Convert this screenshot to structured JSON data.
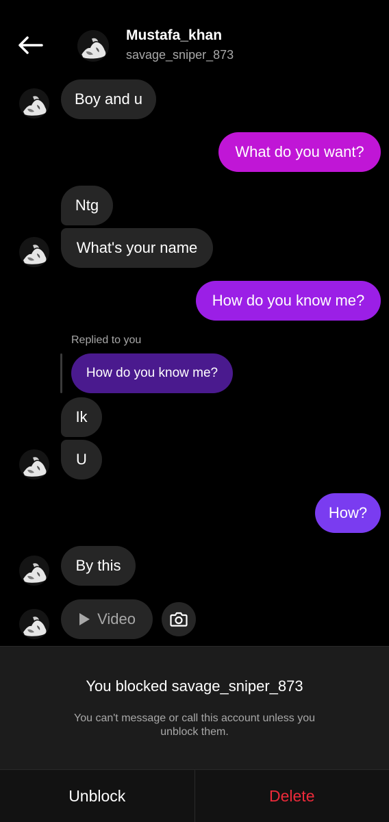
{
  "header": {
    "name": "Mustafa_khan",
    "username": "savage_sniper_873"
  },
  "messages": {
    "m1": "Boy and u",
    "m2": "What do you want?",
    "m3": "Ntg",
    "m4": "What's your name",
    "m5": "How do you know me?",
    "replied_label": "Replied to you",
    "reply_quote": "How do you know me?",
    "m6": "Ik",
    "m7": "U",
    "m8": "How?",
    "m9": "By this",
    "video_label": "Video"
  },
  "blocked": {
    "title": "You blocked savage_sniper_873",
    "description": "You can't message or call this account unless you unblock them."
  },
  "actions": {
    "unblock": "Unblock",
    "delete": "Delete"
  },
  "colors": {
    "background": "#000000",
    "incoming_bubble": "#262626",
    "outgoing_magenta": "#c016d6",
    "outgoing_purple": "#9b1fe6",
    "outgoing_violet": "#7a3cf0",
    "reply_quote": "#4a1a8e",
    "delete_red": "#ed2a3a"
  }
}
